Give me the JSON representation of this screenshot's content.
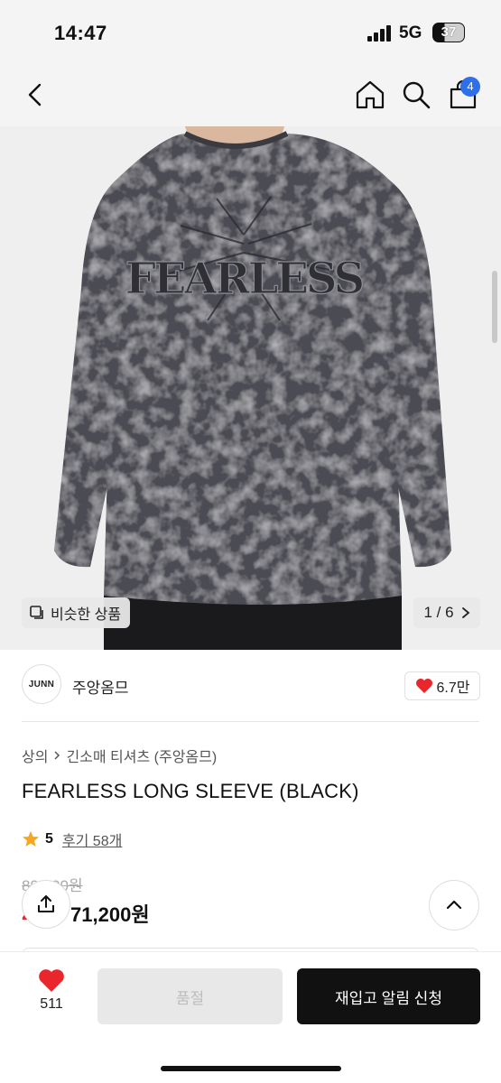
{
  "status_bar": {
    "time": "14:47",
    "network": "5G",
    "battery": "37",
    "battery_level": 0.37
  },
  "nav": {
    "back_icon": "chevron-left-icon",
    "home_icon": "home-icon",
    "search_icon": "search-icon",
    "cart_icon": "shopping-bag-icon",
    "cart_badge": "4"
  },
  "hero": {
    "graphic_text": "FEARLESS",
    "similar_label": "비슷한 상품",
    "page_counter": "1 / 6"
  },
  "brand": {
    "logo_text": "JUNN",
    "name": "주앙옴므",
    "likes": "6.7만"
  },
  "product": {
    "breadcrumb": [
      "상의",
      "긴소매 티셔츠 (주앙옴므)"
    ],
    "title": "FEARLESS LONG SLEEVE (BLACK)",
    "rating": "5",
    "reviews": "후기 58개",
    "original_price": "89,000원",
    "discount_rate": "20%",
    "sale_price": "71,200원"
  },
  "bottom_bar": {
    "wish_count": "511",
    "soldout_label": "품절",
    "restock_label": "재입고 알림 신청"
  },
  "colors": {
    "accent_red": "#e8262c",
    "badge_blue": "#2f6fe8",
    "primary_button": "#111111",
    "shirt": "#4b4b52"
  }
}
